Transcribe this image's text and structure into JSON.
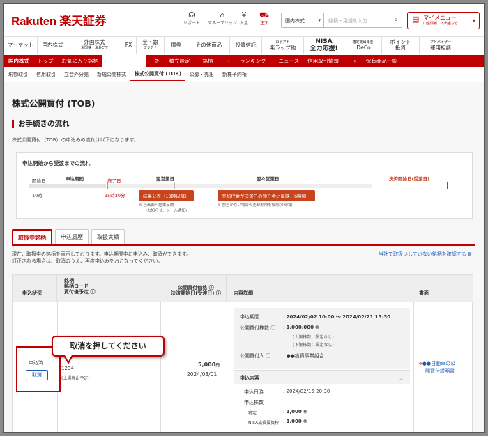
{
  "header": {
    "logo": "Rakuten 楽天証券",
    "icons": [
      {
        "icon": "headset-icon",
        "glyph": "☊",
        "label": "サポート"
      },
      {
        "icon": "bridge-icon",
        "glyph": "⌂",
        "label": "マネーブリッジ"
      },
      {
        "icon": "deposit-icon",
        "glyph": "¥",
        "label": "入金"
      },
      {
        "icon": "cart-icon",
        "glyph": "⛟",
        "label": "注文"
      }
    ],
    "market_select": "国内株式",
    "search_placeholder": "銘柄・用語を入力",
    "mymenu_label": "マイメニュー",
    "mymenu_sub": "口座情報・入出金など"
  },
  "nav": [
    {
      "label": "マーケット",
      "sub": ""
    },
    {
      "label": "国内株式",
      "sub": ""
    },
    {
      "label": "外国株式",
      "sub": "米国株・海外ETF"
    },
    {
      "label": "FX",
      "sub": ""
    },
    {
      "label": "金・銀",
      "sub": "プラチナ"
    },
    {
      "label": "債券",
      "sub": ""
    },
    {
      "label": "その他商品",
      "sub": ""
    },
    {
      "label": "投資信託",
      "sub": ""
    },
    {
      "label": "ロボアド",
      "sub": "楽ラップ他"
    },
    {
      "label": "NISA",
      "sub": "全力応援!"
    },
    {
      "label": "確定拠出年金",
      "sub": "iDeCo"
    },
    {
      "label": "ポイント",
      "sub": "投資"
    },
    {
      "label": "アドバイザー",
      "sub": "運用相談"
    }
  ],
  "subnav1": [
    "国内株式",
    "トップ",
    "お気に入り銘柄",
    "注文",
    "積立設定",
    "銘柄",
    "ランキング",
    "ニュース",
    "信用取引情報",
    "保有商品一覧"
  ],
  "subnav2": [
    "現物取引",
    "信用取引",
    "立会外分売",
    "新規公開株式",
    "株式公開買付 (TOB)",
    "公募・売出",
    "新株予約権"
  ],
  "page_title": "株式公開買付 (TOB)",
  "section_title": "お手続きの流れ",
  "section_desc": "株式公開買付（TOB）の申込みの流れは以下になります。",
  "flow": {
    "title": "申込開始から受渡までの流れ",
    "labels": {
      "start": "開始日",
      "period": "申込期間",
      "end": "終了日",
      "next": "翌営業日",
      "next2": "翌々営業日",
      "settle": "決済開始日(受渡日)",
      "start_time": "10時",
      "end_time": "15時30分"
    },
    "pill1": "結果公表（18時以降）",
    "pill2": "売却代金が決済日の預り金に反映（6時頃）",
    "note1a": "※ 当画面へ結果反映",
    "note1b": "(お知らせ、メール通知)",
    "note2": "※ 割当がない場合の売却制限を解除(6時頃)"
  },
  "tabs": [
    "取扱中銘柄",
    "申込履歴",
    "取扱実績"
  ],
  "info1": "現在、取扱中の銘柄を表示しております。申込期間中に申込み、取消ができます。",
  "info2": "訂正される場合は、取消のうえ、再度申込みをおこなってください。",
  "link": "当社で取扱いしていない銘柄を確認する",
  "table": {
    "h_status": "申込状況",
    "h_stock1": "銘柄",
    "h_stock2": "銘柄コード",
    "h_stock3": "買付後予定",
    "h_price1": "公開買付価格",
    "h_price2": "決済開始日(受渡日)",
    "h_detail": "内容詳細",
    "h_doc": "書面",
    "status": "申込済",
    "cancel": "取消",
    "code": "1234",
    "plan": "(上場廃止予定)",
    "price": "5,000",
    "price_unit": "円",
    "settle_date": "2024/03/01",
    "period_label": "申込期間",
    "period_value": "2024/02/02 10:00 〜 2024/02/21 15:30",
    "shares_label": "公開買付株数",
    "shares_value": "1,000,000",
    "shares_unit": "株",
    "upper": "(上限株数：設定なし)",
    "lower": "(下限株数：設定なし)",
    "agent_label": "公開買付人",
    "agent_value": "●●投資事業組合",
    "app_title": "申込内容",
    "app_date_label": "申込日時",
    "app_date_value": "2024/02/15 20:30",
    "app_shares_label": "申込株数",
    "tokutei_label": "特定",
    "tokutei_value": "1,000",
    "nisa_label": "NISA成長投資枠",
    "nisa_value": "1,000",
    "doc_link1": "●●自動車の公",
    "doc_link2": "開買付説明書"
  },
  "callout": "取消を押してください"
}
